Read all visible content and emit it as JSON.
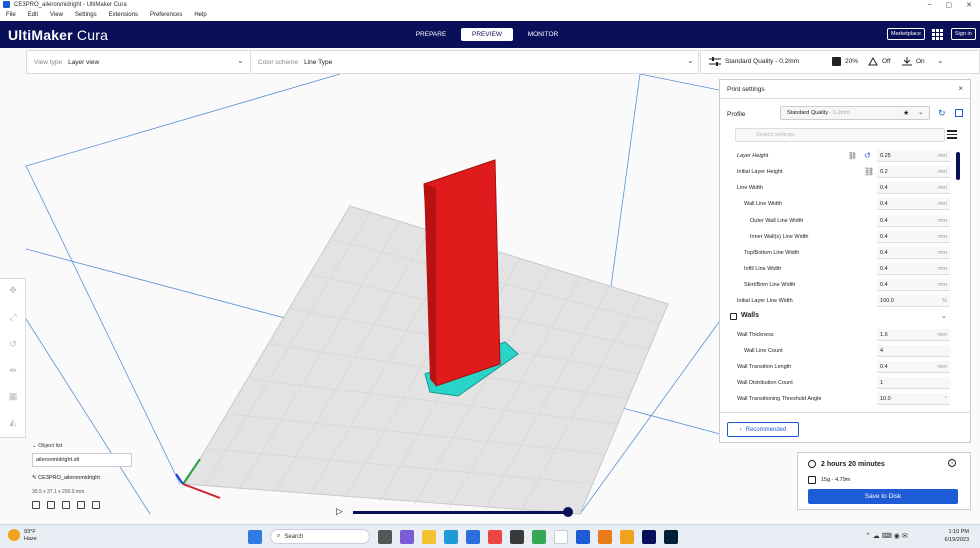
{
  "window": {
    "title": "CE3PRO_aileronmidright - UltiMaker Cura"
  },
  "menu": [
    "File",
    "Edit",
    "View",
    "Settings",
    "Extensions",
    "Preferences",
    "Help"
  ],
  "header": {
    "logo_bold": "UltiMaker",
    "logo_light": "Cura",
    "stages": [
      "PREPARE",
      "PREVIEW",
      "MONITOR"
    ],
    "active_stage": "PREVIEW",
    "marketplace": "Marketplace",
    "signin": "Sign in"
  },
  "toolbar": {
    "view_type_label": "View type",
    "view_type_value": "Layer view",
    "color_scheme_label": "Color scheme",
    "color_scheme_value": "Line Type"
  },
  "quality": {
    "profile": "Standard Quality - 0.2mm",
    "infill": "20%",
    "support": "Off",
    "adhesion": "On"
  },
  "print_settings": {
    "title": "Print settings",
    "profile_label": "Profile",
    "profile_value": "Standard Quality",
    "profile_sub": "- 0.2mm",
    "search_placeholder": "Search settings",
    "rows": [
      {
        "label": "Layer Height",
        "value": "0.25",
        "unit": "mm"
      },
      {
        "label": "Initial Layer Height",
        "value": "0.2",
        "unit": "mm"
      },
      {
        "label": "Line Width",
        "value": "0.4",
        "unit": "mm"
      },
      {
        "label": "Wall Line Width",
        "value": "0.4",
        "unit": "mm"
      },
      {
        "label": "Outer Wall Line Width",
        "value": "0.4",
        "unit": "mm"
      },
      {
        "label": "Inner Wall(s) Line Width",
        "value": "0.4",
        "unit": "mm"
      },
      {
        "label": "Top/Bottom Line Width",
        "value": "0.4",
        "unit": "mm"
      },
      {
        "label": "Infill Line Width",
        "value": "0.4",
        "unit": "mm"
      },
      {
        "label": "Skirt/Brim Line Width",
        "value": "0.4",
        "unit": "mm"
      },
      {
        "label": "Initial Layer Line Width",
        "value": "100.0",
        "unit": "%"
      }
    ],
    "walls_section": "Walls",
    "wall_rows": [
      {
        "label": "Wall Thickness",
        "value": "1.6",
        "unit": "mm"
      },
      {
        "label": "Wall Line Count",
        "value": "4",
        "unit": ""
      },
      {
        "label": "Wall Transition Length",
        "value": "0.4",
        "unit": "mm"
      },
      {
        "label": "Wall Distribution Count",
        "value": "1",
        "unit": ""
      },
      {
        "label": "Wall Transitioning Threshold Angle",
        "value": "10.0",
        "unit": "°"
      }
    ],
    "recommended": "Recommended"
  },
  "estimate": {
    "time": "2 hours 20 minutes",
    "material": "15g · 4.79m",
    "save": "Save to Disk"
  },
  "object_list": {
    "header": "Object list",
    "item": "aileronmidright.stl",
    "job": "CE3PRO_aileronmidright",
    "dims": "30.5 x 37.1 x 200.0 mm"
  },
  "taskbar": {
    "temp": "93°F",
    "weather": "Haze",
    "search": "Search",
    "time": "1:10 PM",
    "date": "6/19/2023"
  },
  "colors": {
    "header": "#0a0f5a",
    "accent": "#1e5bd6",
    "wall": "#e01b1b",
    "skin": "#2ad4c9"
  }
}
